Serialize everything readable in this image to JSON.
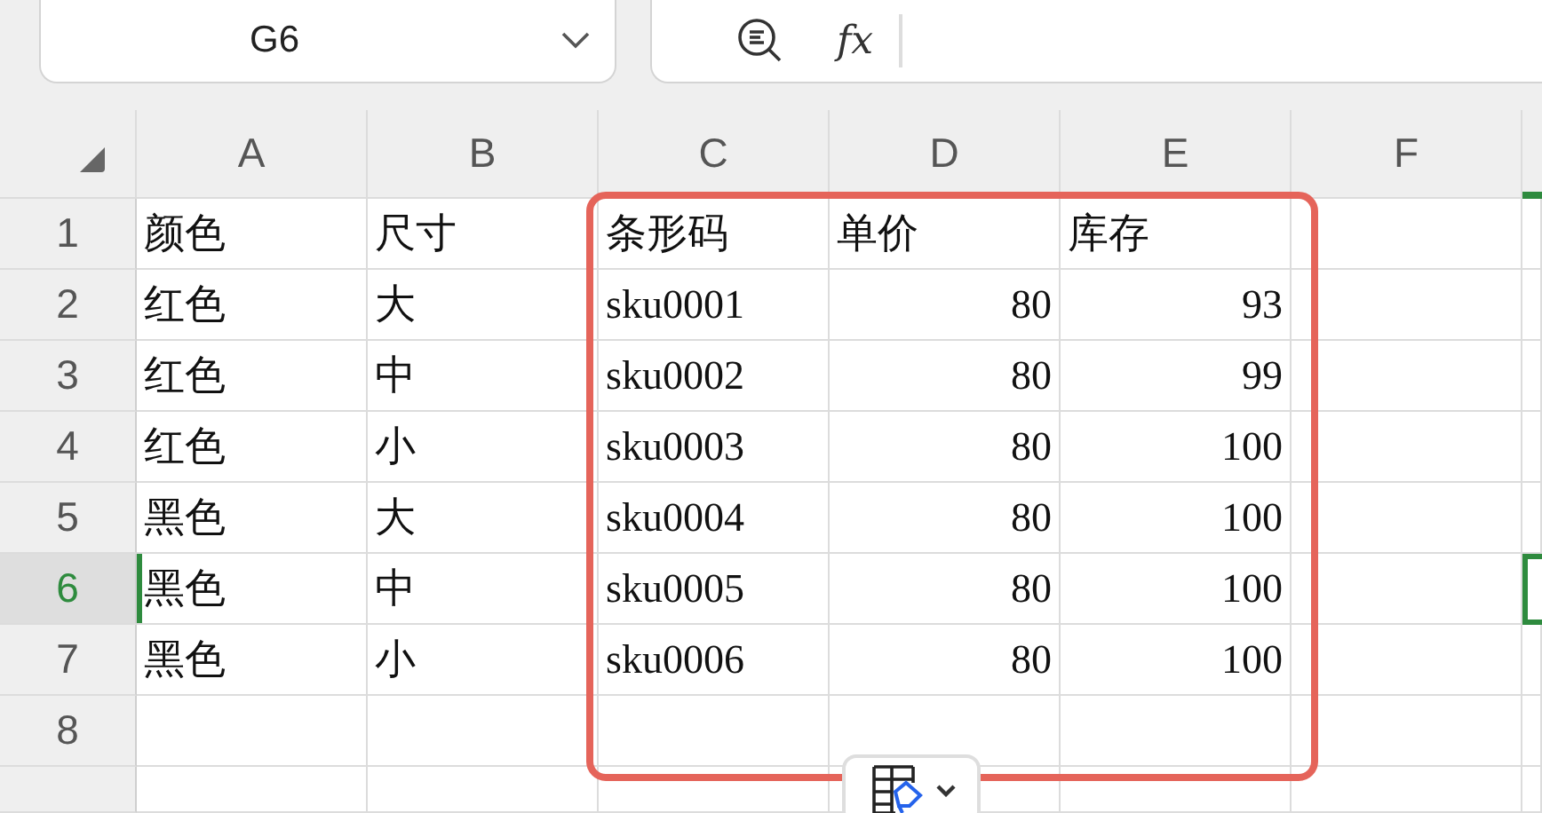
{
  "name_box": {
    "value": "G6"
  },
  "formula_bar": {
    "function_label": "fx"
  },
  "columns": [
    {
      "label": "A",
      "selected": false
    },
    {
      "label": "B",
      "selected": false
    },
    {
      "label": "C",
      "selected": false
    },
    {
      "label": "D",
      "selected": false
    },
    {
      "label": "E",
      "selected": false
    },
    {
      "label": "F",
      "selected": false
    }
  ],
  "partial_column": {
    "selected": true
  },
  "rows": [
    {
      "number": "1",
      "selected": false,
      "cells": [
        {
          "text": "颜色",
          "kind": "text"
        },
        {
          "text": "尺寸",
          "kind": "text"
        },
        {
          "text": "条形码",
          "kind": "text"
        },
        {
          "text": "单价",
          "kind": "text"
        },
        {
          "text": "库存",
          "kind": "text"
        }
      ]
    },
    {
      "number": "2",
      "selected": false,
      "cells": [
        {
          "text": "红色",
          "kind": "text"
        },
        {
          "text": "大",
          "kind": "text"
        },
        {
          "text": "sku0001",
          "kind": "text"
        },
        {
          "text": "80",
          "kind": "number"
        },
        {
          "text": "93",
          "kind": "number"
        }
      ]
    },
    {
      "number": "3",
      "selected": false,
      "cells": [
        {
          "text": "红色",
          "kind": "text"
        },
        {
          "text": "中",
          "kind": "text"
        },
        {
          "text": "sku0002",
          "kind": "text"
        },
        {
          "text": "80",
          "kind": "number"
        },
        {
          "text": "99",
          "kind": "number"
        }
      ]
    },
    {
      "number": "4",
      "selected": false,
      "cells": [
        {
          "text": "红色",
          "kind": "text"
        },
        {
          "text": "小",
          "kind": "text"
        },
        {
          "text": "sku0003",
          "kind": "text"
        },
        {
          "text": "80",
          "kind": "number"
        },
        {
          "text": "100",
          "kind": "number"
        }
      ]
    },
    {
      "number": "5",
      "selected": false,
      "cells": [
        {
          "text": "黑色",
          "kind": "text"
        },
        {
          "text": "大",
          "kind": "text"
        },
        {
          "text": "sku0004",
          "kind": "text"
        },
        {
          "text": "80",
          "kind": "number"
        },
        {
          "text": "100",
          "kind": "number"
        }
      ]
    },
    {
      "number": "6",
      "selected": true,
      "cells": [
        {
          "text": "黑色",
          "kind": "text"
        },
        {
          "text": "中",
          "kind": "text"
        },
        {
          "text": "sku0005",
          "kind": "text"
        },
        {
          "text": "80",
          "kind": "number"
        },
        {
          "text": "100",
          "kind": "number"
        }
      ]
    },
    {
      "number": "7",
      "selected": false,
      "cells": [
        {
          "text": "黑色",
          "kind": "text"
        },
        {
          "text": "小",
          "kind": "text"
        },
        {
          "text": "sku0006",
          "kind": "text"
        },
        {
          "text": "80",
          "kind": "number"
        },
        {
          "text": "100",
          "kind": "number"
        }
      ]
    },
    {
      "number": "8",
      "selected": false
    },
    {
      "selected": false
    }
  ],
  "annotation": {
    "kind": "outline"
  }
}
